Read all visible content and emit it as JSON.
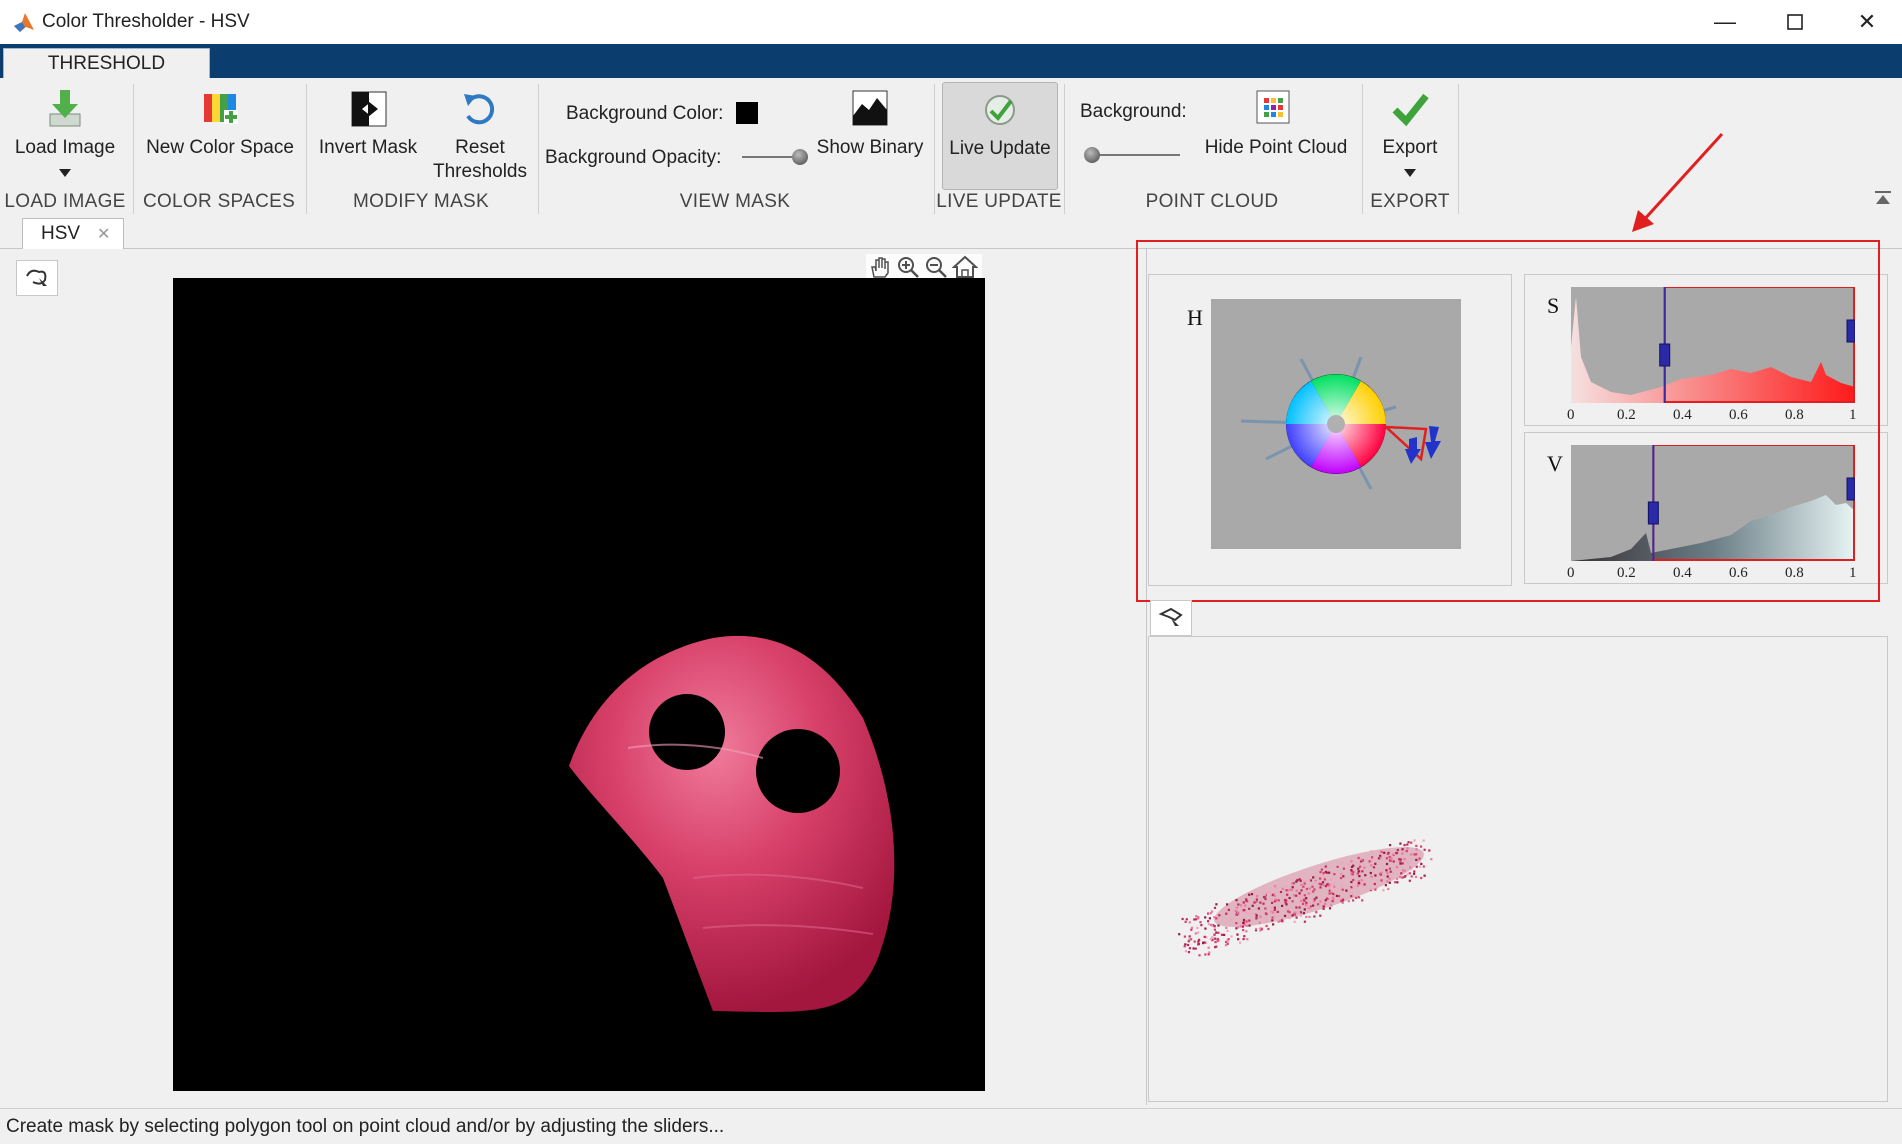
{
  "window": {
    "title": "Color Thresholder - HSV",
    "minimize_glyph": "—",
    "maximize_glyph": "☐",
    "close_glyph": "✕"
  },
  "ribbon": {
    "tab": "THRESHOLD",
    "groups": {
      "load_image": "LOAD IMAGE",
      "color_spaces": "COLOR SPACES",
      "modify_mask": "MODIFY MASK",
      "view_mask": "VIEW MASK",
      "live_update": "LIVE UPDATE",
      "point_cloud": "POINT CLOUD",
      "export": "EXPORT"
    },
    "buttons": {
      "load_image": "Load Image",
      "new_color_space": "New Color Space",
      "invert_mask": "Invert Mask",
      "reset_thresholds_line1": "Reset",
      "reset_thresholds_line2": "Thresholds",
      "background_color": "Background Color:",
      "background_opacity": "Background Opacity:",
      "show_binary": "Show Binary",
      "live_update": "Live Update",
      "background": "Background:",
      "hide_point_cloud": "Hide Point Cloud",
      "export": "Export"
    },
    "background_color_value": "#000000",
    "background_opacity_value": 1.0,
    "point_cloud_background_value": 0.0,
    "live_update_pressed": true
  },
  "document_tab": {
    "label": "HSV",
    "close_glyph": "✕"
  },
  "histograms": {
    "h_label": "H",
    "s_label": "S",
    "v_label": "V",
    "s_ticks": [
      "0",
      "0.2",
      "0.4",
      "0.6",
      "0.8",
      "1"
    ],
    "v_ticks": [
      "0",
      "0.2",
      "0.4",
      "0.6",
      "0.8",
      "1"
    ],
    "s_threshold": [
      0.33,
      1.0
    ],
    "v_threshold": [
      0.29,
      1.0
    ]
  },
  "status": {
    "message": "Create mask by selecting polygon tool on point cloud and/or by adjusting the sliders..."
  },
  "colors": {
    "ribbon_tabstrip": "#0b3d6e",
    "highlight_box": "#e02020",
    "mask_pink": "#d8416a",
    "slider_handle": "#2a2aa8"
  }
}
